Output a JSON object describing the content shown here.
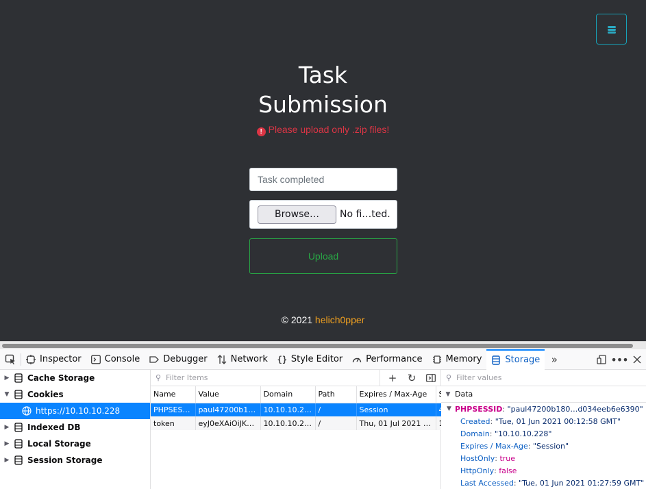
{
  "page": {
    "title_line1": "Task",
    "title_line2": "Submission",
    "error_message": "Please upload only .zip files!",
    "task_placeholder": "Task completed",
    "browse_label": "Browse…",
    "file_status": "No fi…ted.",
    "upload_label": "Upload",
    "footer_copyright": "© 2021",
    "footer_author": "helich0pper",
    "accent_color": "#17a2b8",
    "error_color": "#dc3545",
    "success_color": "#28a745"
  },
  "devtools": {
    "tabs": [
      {
        "label": "Inspector",
        "icon": "inspector-icon"
      },
      {
        "label": "Console",
        "icon": "console-icon"
      },
      {
        "label": "Debugger",
        "icon": "debugger-icon"
      },
      {
        "label": "Network",
        "icon": "network-icon"
      },
      {
        "label": "Style Editor",
        "icon": "style-editor-icon"
      },
      {
        "label": "Performance",
        "icon": "performance-icon"
      },
      {
        "label": "Memory",
        "icon": "memory-icon"
      },
      {
        "label": "Storage",
        "icon": "storage-icon",
        "active": true
      }
    ],
    "sidebar": {
      "cache_storage": "Cache Storage",
      "cookies": "Cookies",
      "cookies_host": "https://10.10.10.228",
      "indexed_db": "Indexed DB",
      "local_storage": "Local Storage",
      "session_storage": "Session Storage"
    },
    "table": {
      "filter_placeholder": "Filter Items",
      "columns": [
        "Name",
        "Value",
        "Domain",
        "Path",
        "Expires / Max-Age",
        "S"
      ],
      "rows": [
        {
          "name": "PHPSES…",
          "value": "paul47200b1…",
          "domain": "10.10.10.2…",
          "path": "/",
          "expires": "Session",
          "s": "4"
        },
        {
          "name": "token",
          "value": "eyJ0eXAiOiJK…",
          "domain": "10.10.10.2…",
          "path": "/",
          "expires": "Thu, 01 Jul 2021 …",
          "s": "1"
        }
      ]
    },
    "data": {
      "filter_placeholder": "Filter values",
      "header": "Data",
      "key": "PHPSESSID",
      "value": "\"paul47200b180…d034eeb6e6390\"",
      "props": [
        {
          "key": "Created",
          "value": "\"Tue, 01 Jun 2021 00:12:58 GMT\"",
          "type": "str"
        },
        {
          "key": "Domain",
          "value": "\"10.10.10.228\"",
          "type": "str"
        },
        {
          "key": "Expires / Max-Age",
          "value": "\"Session\"",
          "type": "str"
        },
        {
          "key": "HostOnly",
          "value": "true",
          "type": "bool"
        },
        {
          "key": "HttpOnly",
          "value": "false",
          "type": "bool"
        },
        {
          "key": "Last Accessed",
          "value": "\"Tue, 01 Jun 2021 01:27:59 GMT\"",
          "type": "str"
        }
      ]
    }
  }
}
